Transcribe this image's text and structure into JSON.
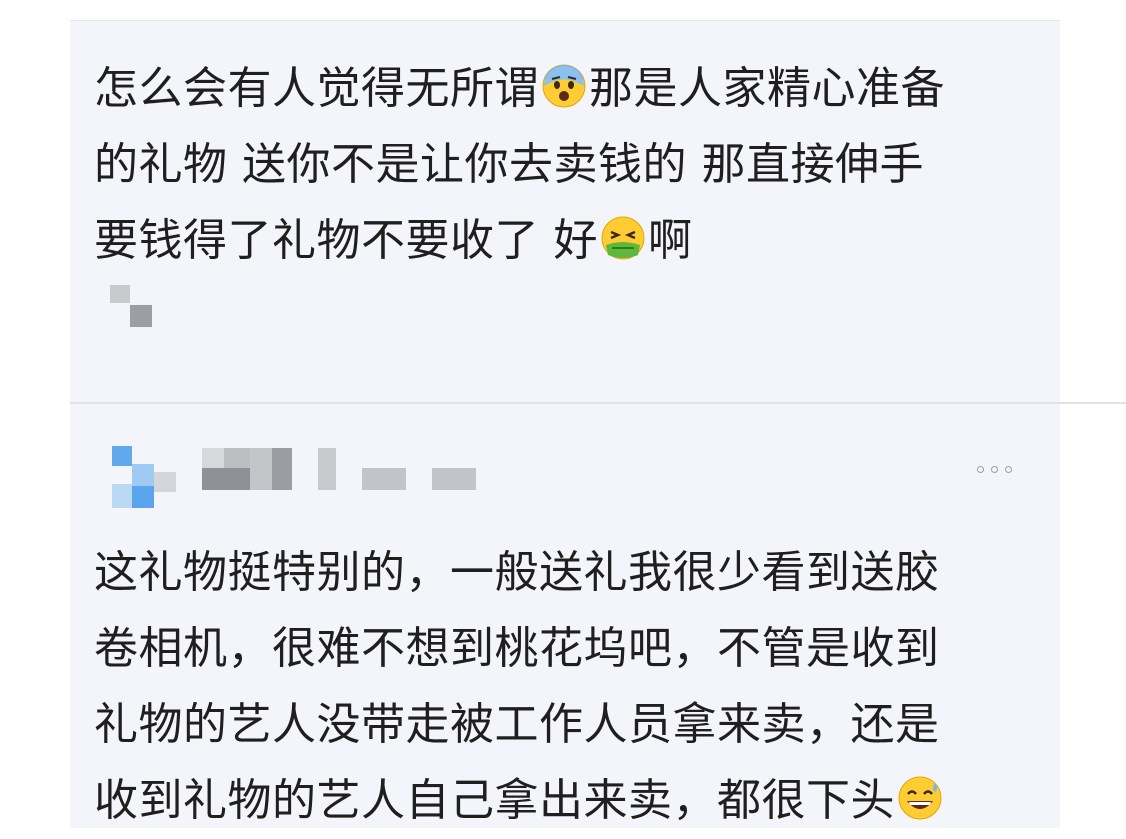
{
  "comments": [
    {
      "lines": [
        "怎么会有人觉得无所谓",
        "那是人家精心准备",
        "的礼物 送你不是让你去卖钱的 那直接伸手",
        "要钱得了礼物不要收了 好",
        "啊"
      ],
      "emoji": [
        "fearful-face-emoji",
        "nauseated-face-emoji"
      ]
    },
    {
      "lines": [
        "这礼物挺特别的，一般送礼我很少看到送胶",
        "卷相机，很难不想到桃花坞吧，不管是收到",
        "礼物的艺人没带走被工作人员拿来卖，还是",
        "收到礼物的艺人自己拿出来卖，都很下头"
      ],
      "emoji": [
        "grinning-sweat-emoji"
      ]
    }
  ],
  "colors": {
    "card_bg": "#f4f5fa",
    "text": "#1f1f1f",
    "more_dots": "#9aa0a8"
  }
}
